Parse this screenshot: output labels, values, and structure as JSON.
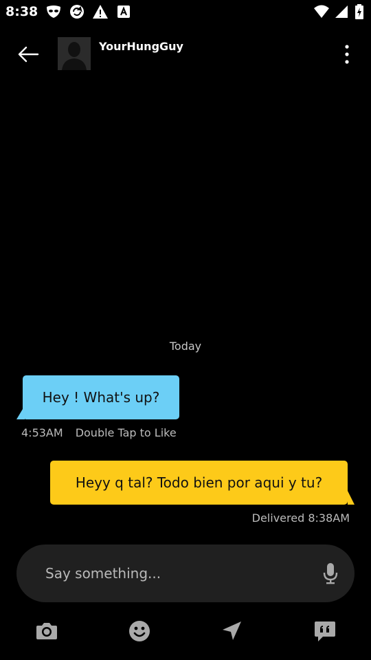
{
  "status_bar": {
    "time": "8:38",
    "left_icons": [
      "grindr-mask-icon",
      "sync-icon",
      "warning-icon",
      "app-a-icon"
    ],
    "right_icons": [
      "wifi-icon",
      "signal-icon",
      "battery-icon"
    ]
  },
  "header": {
    "contact_name": "YourHungGuy",
    "back_icon": "arrow-left-icon",
    "menu_icon": "more-vertical-icon"
  },
  "chat": {
    "date_separator": "Today",
    "messages": [
      {
        "direction": "incoming",
        "text": "Hey ! What's up?",
        "time": "4:53AM",
        "hint": "Double Tap to Like"
      },
      {
        "direction": "outgoing",
        "text": "Heyy q tal? Todo bien por aqui y tu?",
        "status": "Delivered 8:38AM"
      }
    ]
  },
  "composer": {
    "placeholder": "Say something...",
    "value": "",
    "mic_icon": "microphone-icon"
  },
  "toolbar": {
    "items": [
      "camera-icon",
      "emoji-icon",
      "location-icon",
      "saved-phrases-icon"
    ]
  },
  "colors": {
    "background": "#000000",
    "incoming_bubble": "#6ccff6",
    "outgoing_bubble": "#fdca19",
    "composer_bg": "#202020",
    "icon_gray": "#a9a9a9"
  }
}
